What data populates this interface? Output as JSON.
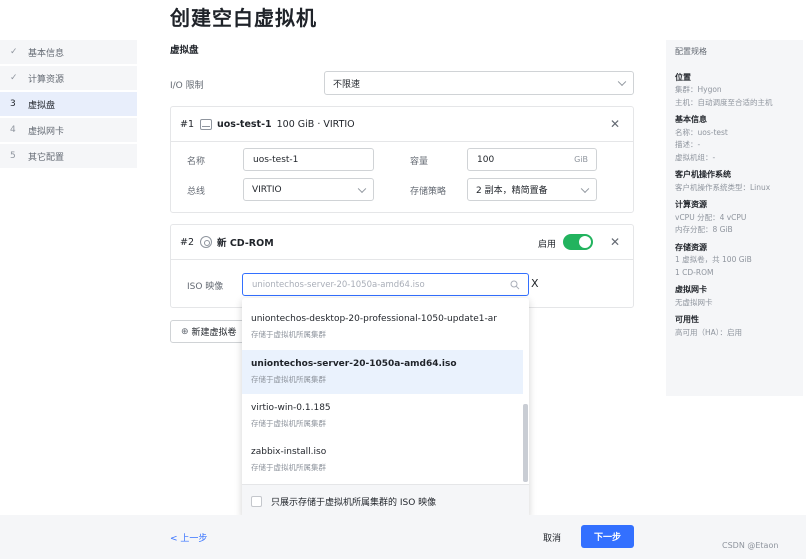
{
  "page": {
    "title": "创建空白虚拟机"
  },
  "steps": [
    {
      "mark": "✓",
      "label": "基本信息"
    },
    {
      "mark": "✓",
      "label": "计算资源"
    },
    {
      "mark": "3",
      "label": "虚拟盘"
    },
    {
      "mark": "4",
      "label": "虚拟网卡"
    },
    {
      "mark": "5",
      "label": "其它配置"
    }
  ],
  "section": {
    "title": "虚拟盘"
  },
  "io_limit": {
    "label": "I/O 限制",
    "value": "不限速"
  },
  "disk1": {
    "index": "#1",
    "name": "uos-test-1",
    "meta": "100 GiB · VIRTIO",
    "name_label": "名称",
    "name_value": "uos-test-1",
    "capacity_label": "容量",
    "capacity_value": "100",
    "capacity_unit": "GiB",
    "bus_label": "总线",
    "bus_value": "VIRTIO",
    "policy_label": "存储策略",
    "policy_value": "2 副本，精简置备"
  },
  "disk2": {
    "index": "#2",
    "name": "新 CD-ROM",
    "enable_label": "启用",
    "enabled": true,
    "iso_label": "ISO 映像",
    "iso_placeholder": "uniontechos-server-20-1050a-amd64.iso",
    "clear": "X"
  },
  "new_disk_button": "新建虚拟卷",
  "dropdown": {
    "options": [
      {
        "name": "uniontechos-desktop-20-professional-1050-update1-ar",
        "sub": "存储于虚拟机所属集群"
      },
      {
        "name": "uniontechos-server-20-1050a-amd64.iso",
        "sub": "存储于虚拟机所属集群",
        "selected": true
      },
      {
        "name": "virtio-win-0.1.185",
        "sub": "存储于虚拟机所属集群"
      },
      {
        "name": "zabbix-install.iso",
        "sub": "存储于虚拟机所属集群"
      }
    ],
    "footer_label": "只展示存储于虚拟机所属集群的 ISO 映像"
  },
  "summary": {
    "title": "配置规格",
    "location_head": "位置",
    "location_cluster": "集群：Hygon",
    "location_host": "主机：自动调度至合适的主机",
    "basic_head": "基本信息",
    "basic_name": "名称：uos-test",
    "basic_desc": "描述：-",
    "basic_group": "虚拟机组：-",
    "os_head": "客户机操作系统",
    "os_type": "客户机操作系统类型：Linux",
    "compute_head": "计算资源",
    "compute_vcpu": "vCPU 分配：4 vCPU",
    "compute_mem": "内存分配：8 GiB",
    "storage_head": "存储资源",
    "storage_disk": "1 虚拟卷，共 100 GiB",
    "storage_cd": "1 CD-ROM",
    "nic_head": "虚拟网卡",
    "nic_value": "无虚拟网卡",
    "ha_head": "可用性",
    "ha_value": "高可用（HA）：启用"
  },
  "footer": {
    "prev": "< 上一步",
    "cancel": "取消",
    "next": "下一步"
  },
  "watermark": "CSDN @Etaon",
  "colors": {
    "primary": "#3370ff",
    "toggle_on": "#22b35e",
    "selected_bg": "#eaf2fd"
  }
}
